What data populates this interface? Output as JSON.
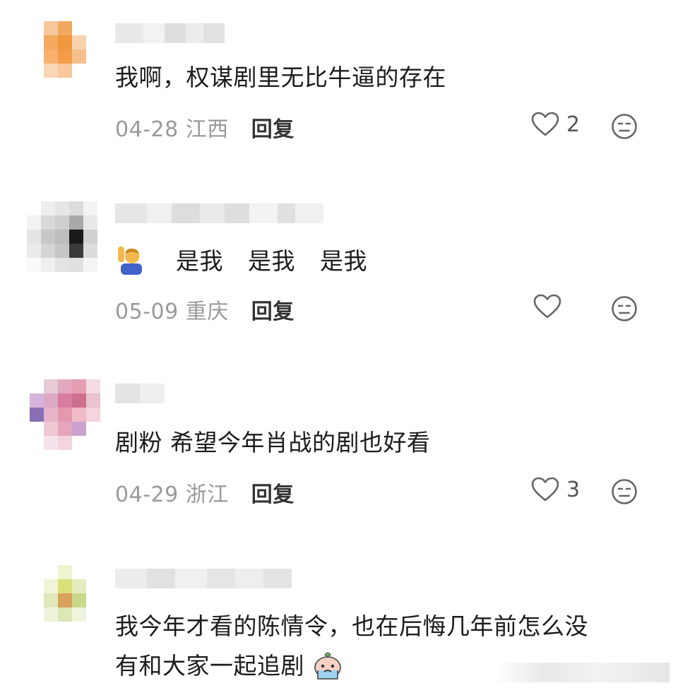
{
  "comments": [
    {
      "text": "我啊，权谋剧里无比牛逼的存在",
      "date": "04-28",
      "location": "江西",
      "reply_label": "回复",
      "likes": "2",
      "avatar_colors": [
        "#ffffff",
        "#f6c79a",
        "#f1a860",
        "#ffffff",
        "#ffffff",
        "#ffffff",
        "#f4a95e",
        "#f0983e",
        "#f7d3b0",
        "#ffffff",
        "#ffffff",
        "#f7b06d",
        "#f39c48",
        "#f6c08e",
        "#ffffff",
        "#ffffff",
        "#fad6b4",
        "#f8c79b",
        "#ffffff",
        "#ffffff",
        "#ffffff",
        "#ffffff",
        "#ffffff",
        "#ffffff",
        "#ffffff"
      ]
    },
    {
      "text_parts": [
        "是我",
        "是我",
        "是我"
      ],
      "emoji": "person-raising-hand-emoji",
      "date": "05-09",
      "location": "重庆",
      "reply_label": "回复",
      "likes": "",
      "avatar_colors": [
        "#ffffff",
        "#eeeeee",
        "#e6e6e6",
        "#dcdcdc",
        "#f4f4f4",
        "#f2f2f2",
        "#d9d9d9",
        "#cfcfcf",
        "#a9a9a9",
        "#e8e8e8",
        "#e4e4e4",
        "#c7c7c7",
        "#bdbdbd",
        "#1a1a1a",
        "#d0d0d0",
        "#ebebeb",
        "#d5d5d5",
        "#c6c6c6",
        "#3a3a3a",
        "#dcdcdc",
        "#fafafa",
        "#efefef",
        "#e3e3e3",
        "#e0e0e0",
        "#f5f5f5"
      ]
    },
    {
      "text": "剧粉 希望今年肖战的剧也好看",
      "date": "04-29",
      "location": "浙江",
      "reply_label": "回复",
      "likes": "3",
      "avatar_colors": [
        "#ffffff",
        "#e8c9d6",
        "#e2a8bf",
        "#e69fb2",
        "#f6dbe3",
        "#d6b3da",
        "#dca9c4",
        "#d77ea0",
        "#cf6f8e",
        "#eac2d0",
        "#8a6fb4",
        "#e7b4c8",
        "#e598ad",
        "#f0bac9",
        "#f4d3dc",
        "#ffffff",
        "#f0c8d4",
        "#e3a6bb",
        "#c9a2cf",
        "#ffffff",
        "#ffffff",
        "#f6e2ea",
        "#f3d4de",
        "#ffffff",
        "#ffffff"
      ]
    },
    {
      "text_line1": "我今年才看的陈情令，也在后悔几年前怎么没",
      "text_line2": "有和大家一起追剧",
      "emoji": "crying-blob-emoji",
      "avatar_colors": [
        "#ffffff",
        "#ffffff",
        "#eef4cf",
        "#ffffff",
        "#ffffff",
        "#ffffff",
        "#f1f4d6",
        "#d9e279",
        "#e5ecc0",
        "#ffffff",
        "#ffffff",
        "#dfe8b9",
        "#d9a15a",
        "#c9d98a",
        "#ffffff",
        "#ffffff",
        "#eef3d9",
        "#dbe7b5",
        "#eef4dd",
        "#ffffff",
        "#ffffff",
        "#ffffff",
        "#ffffff",
        "#ffffff",
        "#ffffff"
      ]
    }
  ],
  "colors": {
    "text_primary": "#1c1c1c",
    "text_meta": "#9a9a9a",
    "reply": "#333333",
    "icon_stroke": "#666666"
  }
}
